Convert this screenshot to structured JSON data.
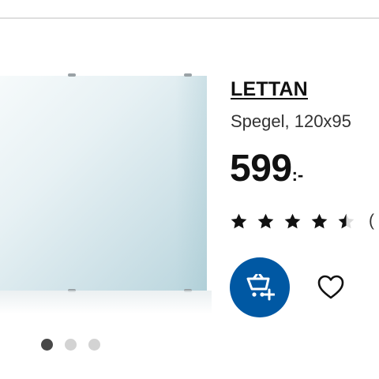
{
  "product": {
    "name": "LETTAN",
    "description": "Spegel, 120x95",
    "price": {
      "integer": "599",
      "suffix": ":-"
    },
    "rating": {
      "value": 4.5,
      "max": 5,
      "review_count_visible": "("
    }
  },
  "gallery": {
    "dots": 3,
    "active_index": 0
  },
  "actions": {
    "add_to_cart_icon": "cart-plus-icon",
    "wishlist_icon": "heart-outline-icon"
  },
  "colors": {
    "accent": "#0058a3",
    "text": "#111111",
    "dot_active": "#484848",
    "dot_inactive": "#d3d3d3"
  }
}
